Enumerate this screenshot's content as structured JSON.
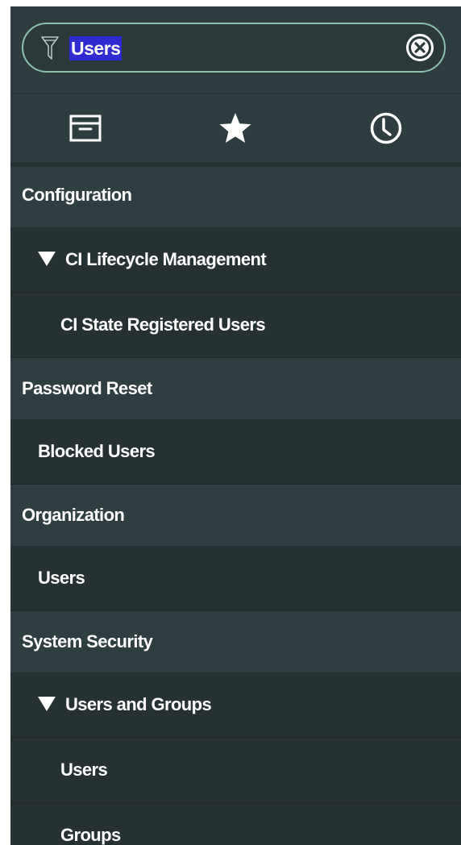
{
  "search": {
    "value": "Users",
    "filter_icon": "filter-icon",
    "clear_icon": "clear-circle-x-icon"
  },
  "tabs": [
    {
      "icon": "archive-icon"
    },
    {
      "icon": "star-icon"
    },
    {
      "icon": "clock-icon"
    }
  ],
  "nav": {
    "configuration": "Configuration",
    "ci_lifecycle": "CI Lifecycle Management",
    "ci_state_registered_users": "CI State Registered Users",
    "password_reset": "Password Reset",
    "blocked_users": "Blocked Users",
    "organization": "Organization",
    "org_users": "Users",
    "system_security": "System Security",
    "users_and_groups": "Users and Groups",
    "sec_users": "Users",
    "sec_groups": "Groups"
  },
  "colors": {
    "panel_bg": "#2e3d3f",
    "item_bg": "#263133",
    "search_border": "#8bbfae",
    "selection_highlight": "#2f2bd0"
  }
}
